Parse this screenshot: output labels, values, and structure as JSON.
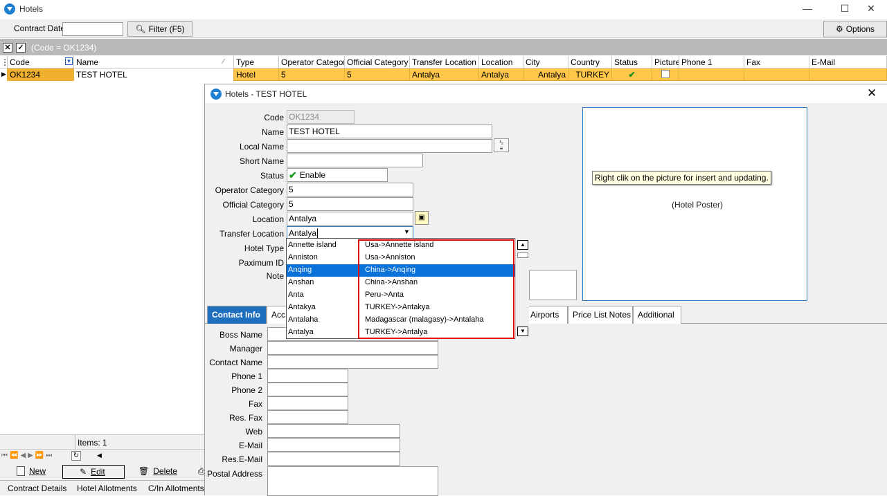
{
  "window": {
    "title": "Hotels",
    "minimize": "—",
    "maximize": "☐",
    "close": "✕"
  },
  "toolbar": {
    "contract_date_label": "Contract Date",
    "contract_date_value": "",
    "filter_label": "Filter (F5)",
    "options_label": "Options"
  },
  "filterbar": {
    "filter_text": "(Code  = OK1234)"
  },
  "grid": {
    "columns": [
      "Code",
      "Name",
      "Type",
      "Operator Category",
      "Official Category",
      "Transfer Location",
      "Location",
      "City",
      "Country",
      "Status",
      "Picture",
      "Phone 1",
      "Fax",
      "E-Mail"
    ],
    "rows": [
      {
        "code": "OK1234",
        "name": "TEST HOTEL",
        "type": "Hotel",
        "operator_category": "5",
        "official_category": "5",
        "transfer_location": "Antalya",
        "location": "Antalya",
        "city": "Antalya",
        "country": "TURKEY",
        "status": "✔",
        "picture": "",
        "phone1": "",
        "fax": "",
        "email": ""
      }
    ]
  },
  "leftbottom": {
    "items_label": "Items: 1",
    "new_label": "New",
    "edit_label": "Edit",
    "delete_label": "Delete",
    "tab1": "Contract Details",
    "tab2": "Hotel Allotments",
    "tab3": "C/In Allotments"
  },
  "dialog": {
    "title": "Hotels - TEST HOTEL",
    "fields": {
      "code_label": "Code",
      "code_value": "OK1234",
      "name_label": "Name",
      "name_value": "TEST HOTEL",
      "local_name_label": "Local Name",
      "local_name_value": "",
      "short_name_label": "Short Name",
      "short_name_value": "",
      "status_label": "Status",
      "status_value": "Enable",
      "operator_category_label": "Operator Category",
      "operator_category_value": "5",
      "official_category_label": "Official Category",
      "official_category_value": "5",
      "location_label": "Location",
      "location_value": "Antalya",
      "transfer_location_label": "Transfer Location",
      "transfer_location_value": "Antalya",
      "hotel_type_label": "Hotel Type",
      "paximum_id_label": "Paximum ID",
      "note_label": "Note"
    },
    "poster_text": "(Hotel Poster)",
    "tooltip": "Right clik on the picture for insert and updating.",
    "tabs": [
      "Contact Info",
      "Acc",
      "Airports",
      "Price List Notes",
      "Additional"
    ],
    "dropdown_items": [
      {
        "name": "Annette island",
        "full": "Usa->Annette island"
      },
      {
        "name": "Anniston",
        "full": "Usa->Anniston"
      },
      {
        "name": "Anqing",
        "full": "China->Anqing"
      },
      {
        "name": "Anshan",
        "full": "China->Anshan"
      },
      {
        "name": "Anta",
        "full": "Peru->Anta"
      },
      {
        "name": "Antakya",
        "full": "TURKEY->Antakya"
      },
      {
        "name": "Antalaha",
        "full": "Madagascar (malagasy)->Antalaha"
      },
      {
        "name": "Antalya",
        "full": "TURKEY->Antalya"
      }
    ],
    "contact": {
      "boss_name": "Boss Name",
      "manager": "Manager",
      "contact_name": "Contact Name",
      "phone1": "Phone 1",
      "phone2": "Phone 2",
      "fax": "Fax",
      "res_fax": "Res. Fax",
      "web": "Web",
      "email": "E-Mail",
      "res_email": "Res.E-Mail",
      "postal_address": "Postal Address"
    }
  }
}
